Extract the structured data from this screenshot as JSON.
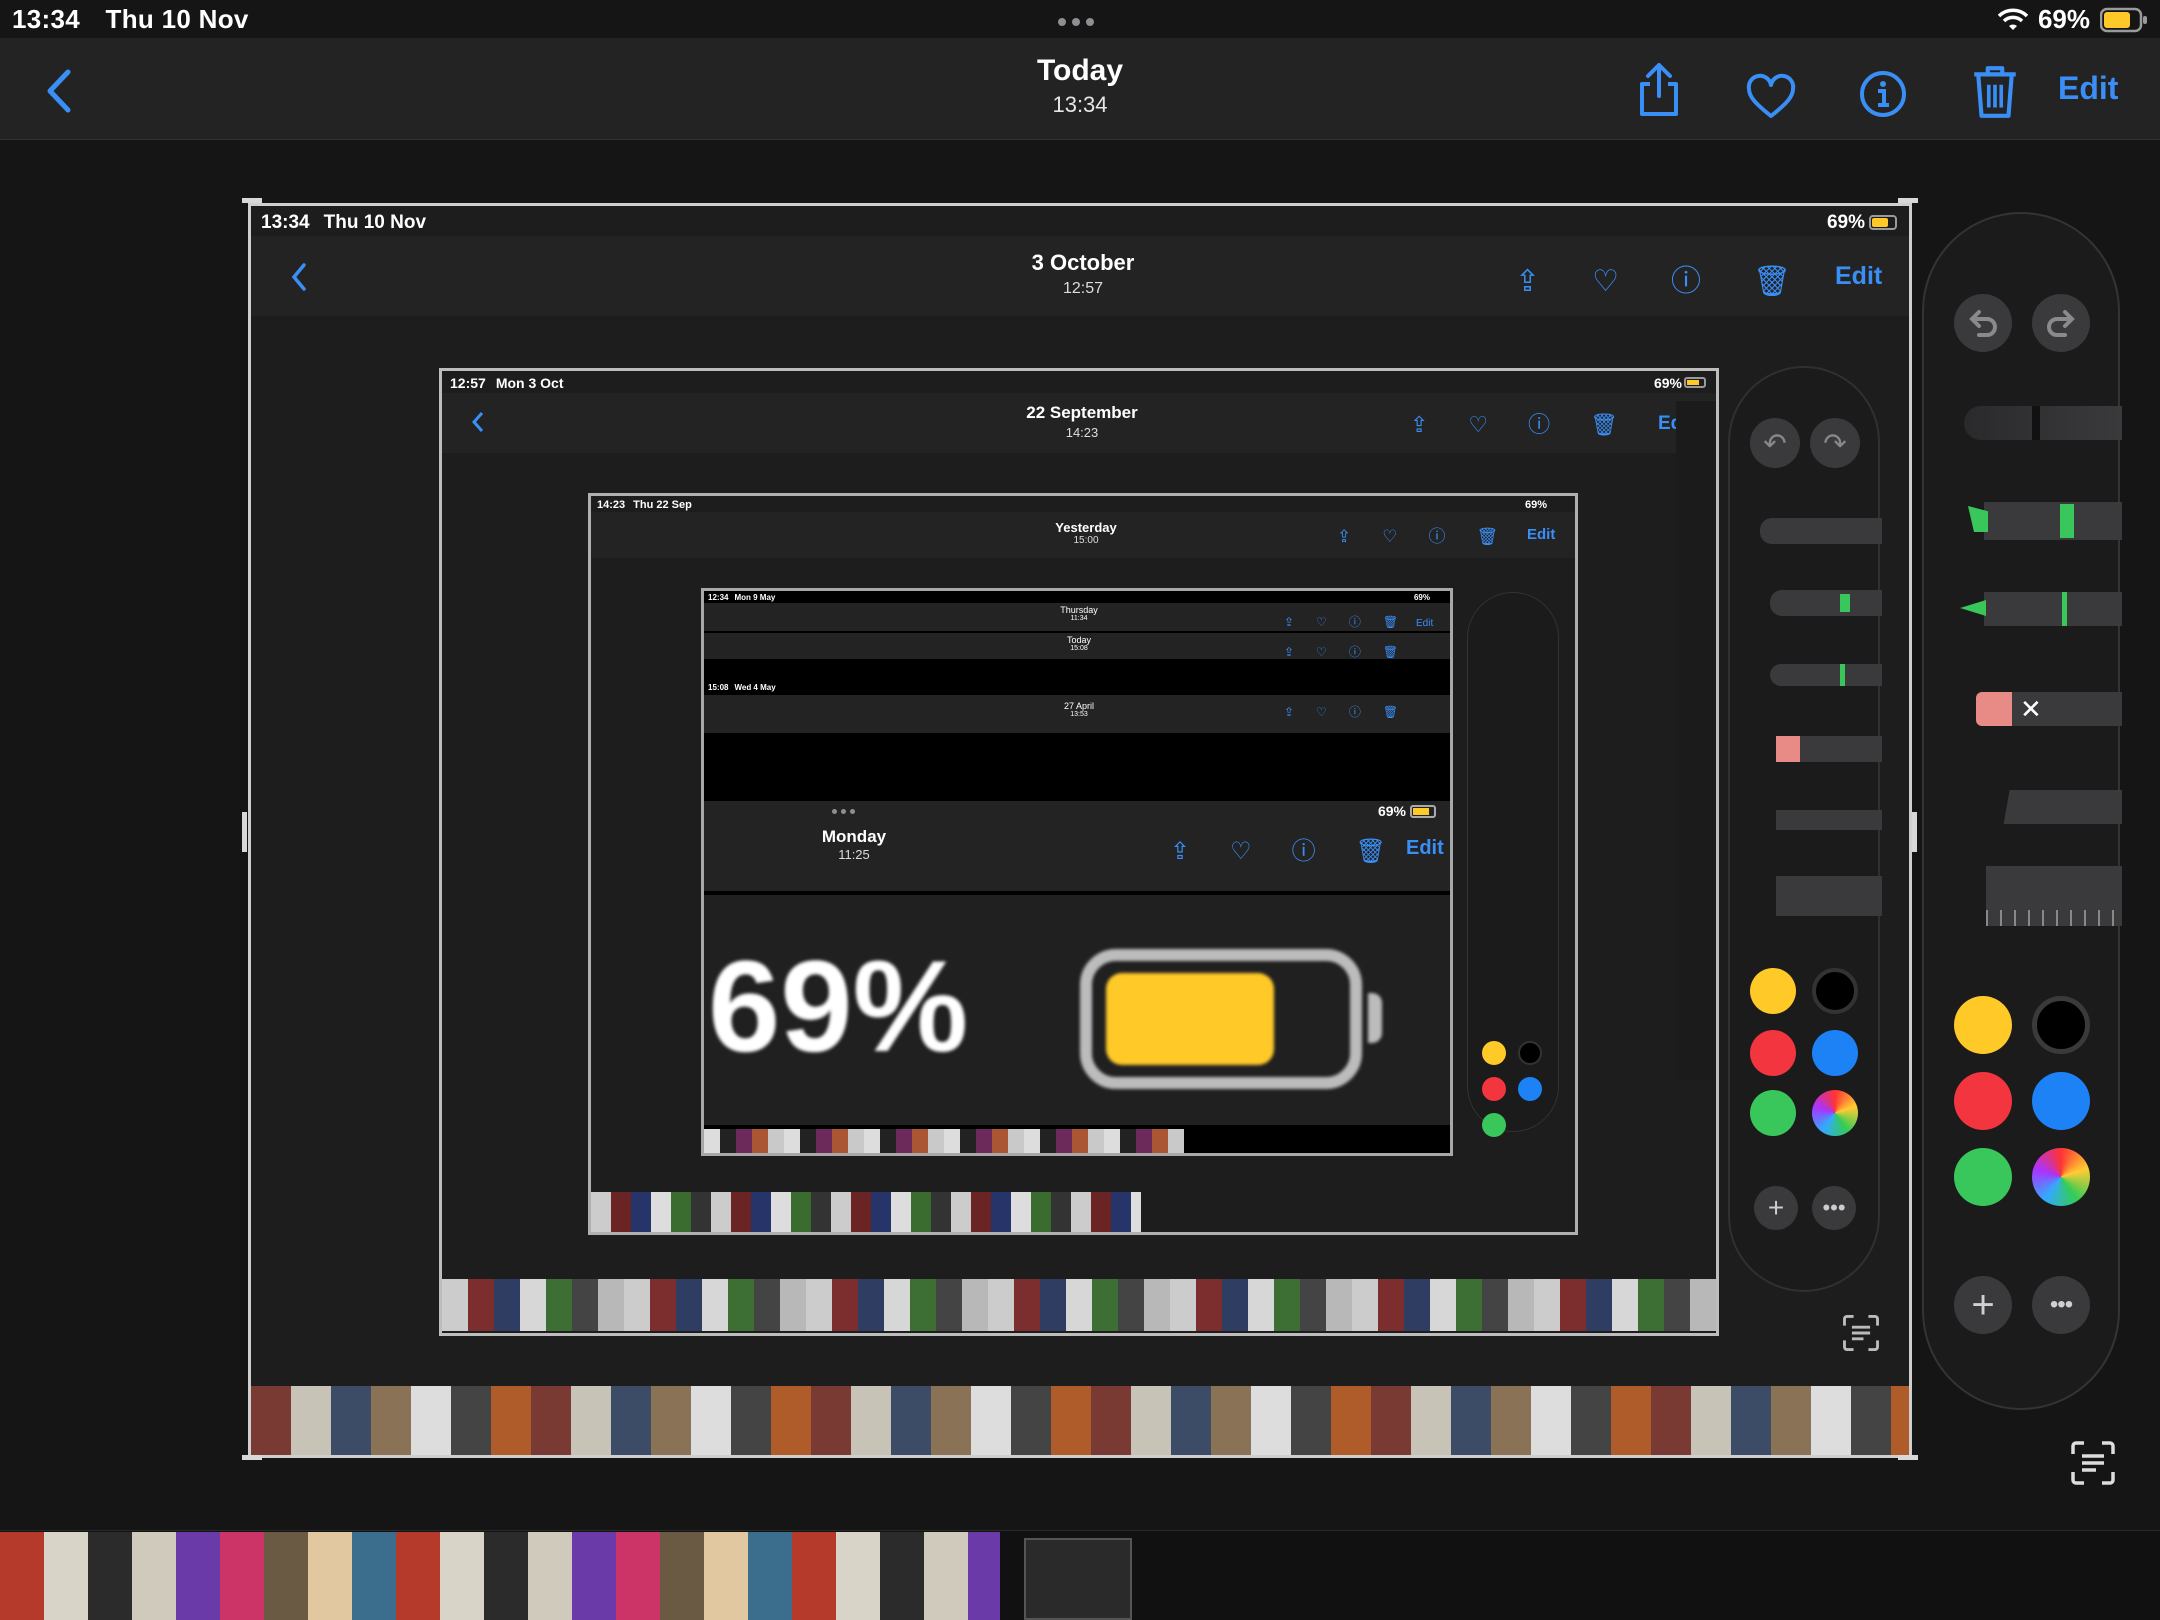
{
  "status": {
    "time": "13:34",
    "date": "Thu 10 Nov",
    "battery": "69%",
    "icons": [
      "wifi-icon",
      "battery-icon"
    ]
  },
  "header": {
    "title": "Today",
    "subtitle": "13:34",
    "edit_label": "Edit",
    "icons": [
      "back-chevron-icon",
      "share-icon",
      "heart-icon",
      "info-icon",
      "trash-icon"
    ]
  },
  "level1": {
    "time": "13:34",
    "date": "Thu 10 Nov",
    "battery": "69%",
    "title": "3 October",
    "subtitle": "12:57",
    "edit_label": "Edit"
  },
  "level2": {
    "time": "12:57",
    "date": "Mon 3 Oct",
    "battery": "69%",
    "title": "22 September",
    "subtitle": "14:23",
    "edit_label": "Edit"
  },
  "level3": {
    "time": "14:23",
    "date": "Thu 22 Sep",
    "battery": "69%",
    "title": "Yesterday",
    "subtitle": "15:00",
    "edit_label": "Edit"
  },
  "level4": {
    "time": "12:34",
    "date": "Mon 9 May",
    "battery": "69%",
    "title_a": "Thursday",
    "subtitle_a": "11:34",
    "title_b": "Today",
    "subtitle_b": "15:08",
    "time_c": "15:08",
    "date_c": "Wed 4 May",
    "title_c": "27 April",
    "subtitle_c": "13:53",
    "edit_label": "Edit"
  },
  "level5": {
    "battery": "69%",
    "title": "Monday",
    "subtitle": "11:25",
    "edit_label": "Edit",
    "big_battery": "69%"
  },
  "palette": {
    "tools": [
      "undo-icon",
      "redo-icon",
      "pen-tool",
      "highlighter-tool",
      "marker-tool",
      "eraser-tool",
      "pencil-tool",
      "ruler-tool"
    ],
    "colors": [
      "#ffc928",
      "#000000",
      "#f2353e",
      "#1e82f7",
      "#39c75c",
      "multicolor"
    ],
    "buttons": [
      "plus-icon",
      "more-icon"
    ]
  },
  "colors": {
    "accent": "#3a8ff7",
    "battery": "#ffc928",
    "background": "#151515",
    "bar": "#232324"
  }
}
